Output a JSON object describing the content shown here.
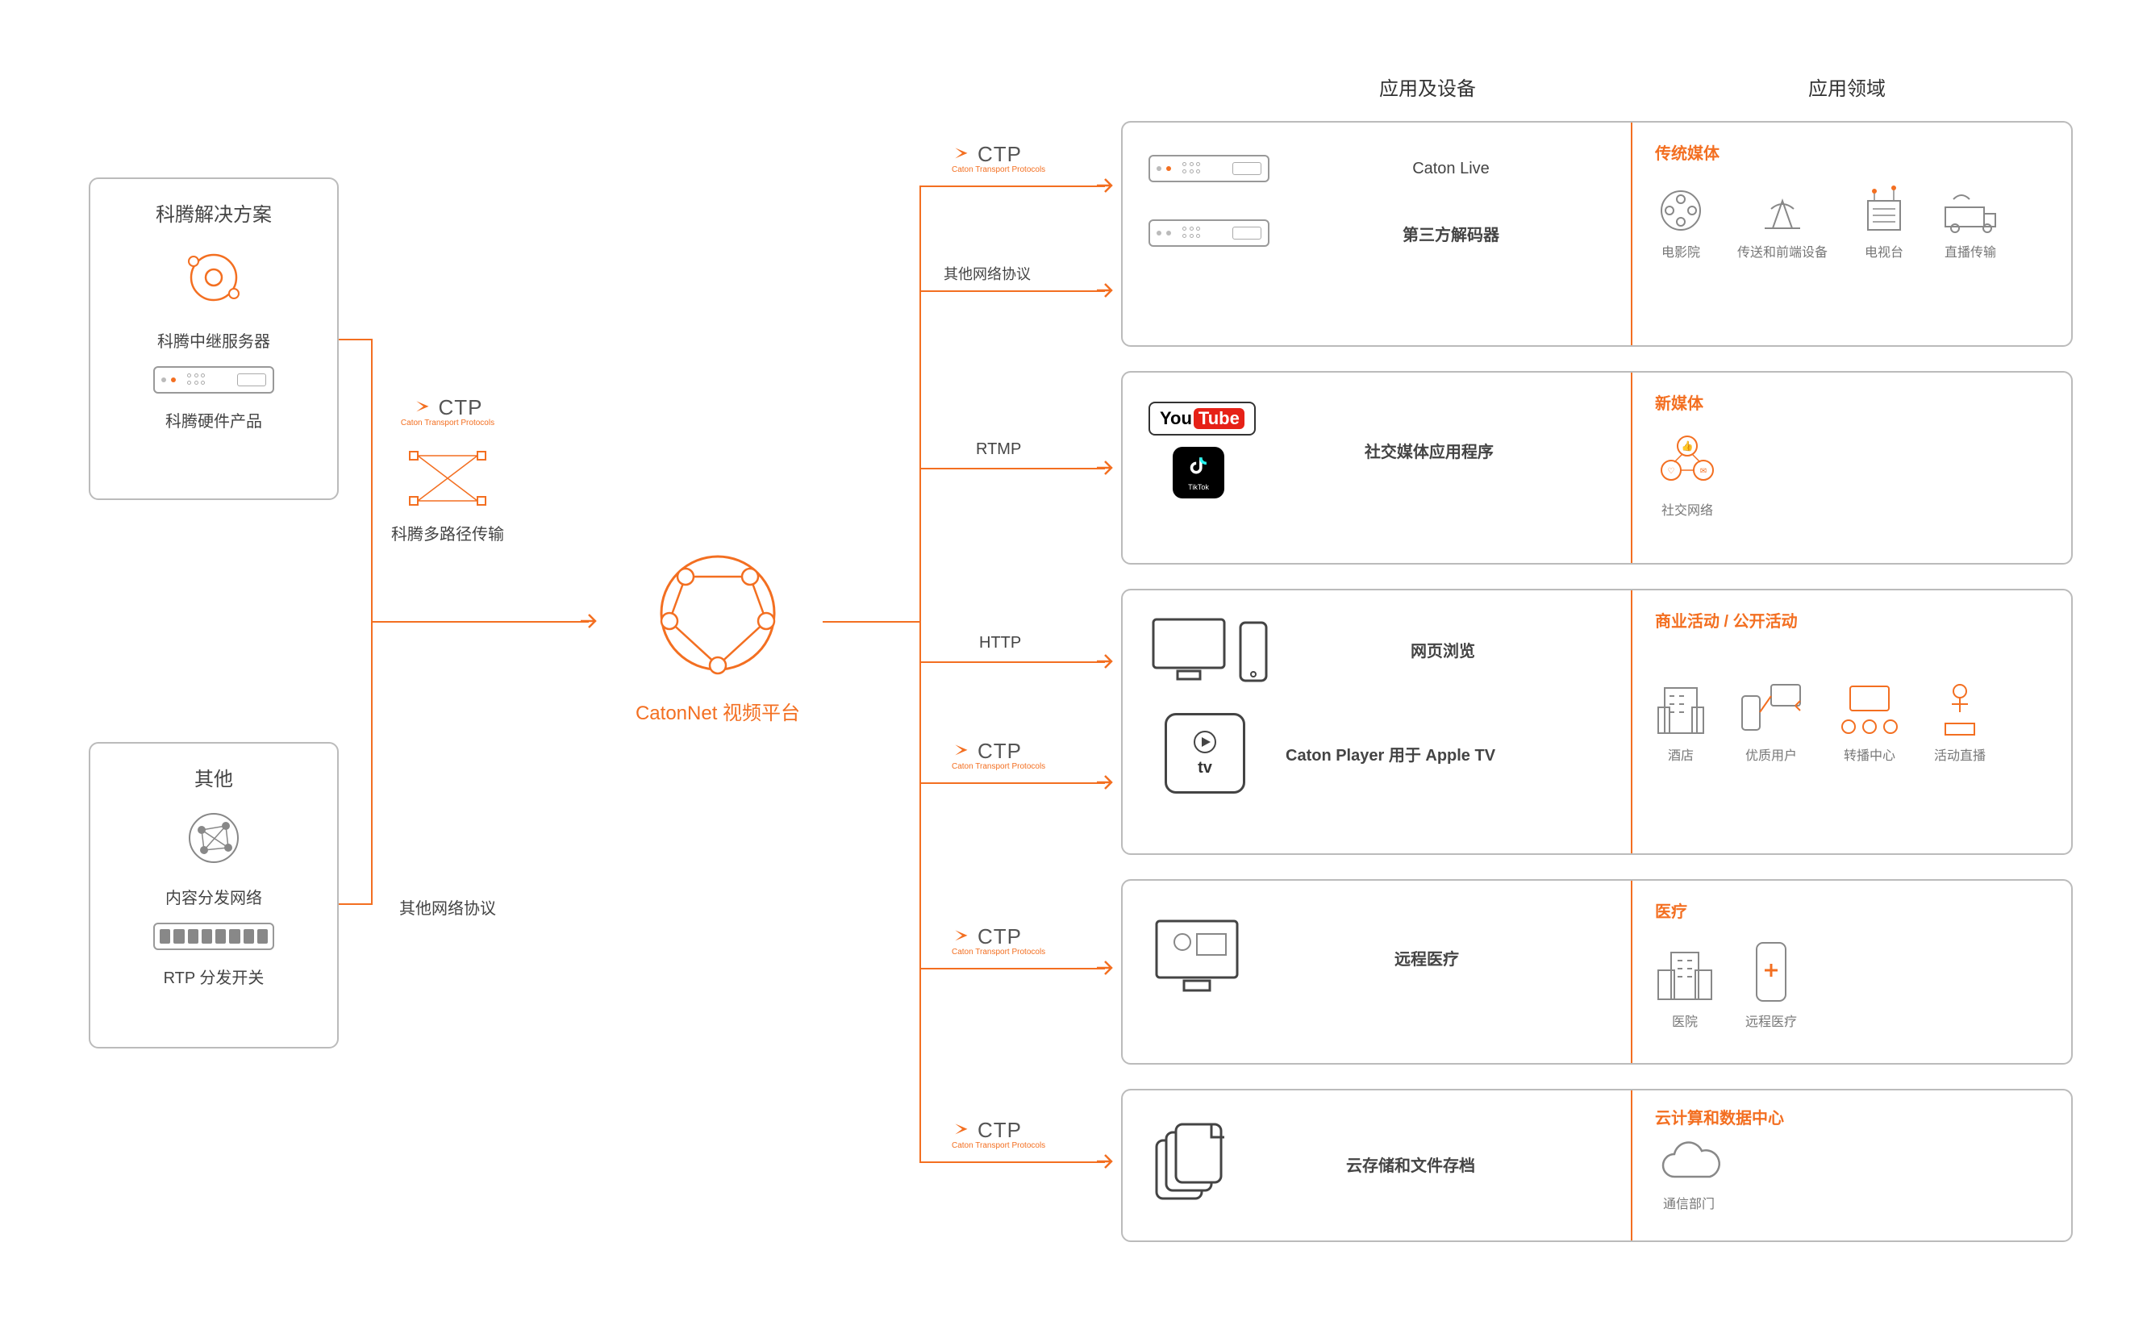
{
  "headers": {
    "apps_devices": "应用及设备",
    "domains": "应用领域"
  },
  "left": {
    "box1_title": "科腾解决方案",
    "box1_item1": "科腾中继服务器",
    "box1_item2": "科腾硬件产品",
    "box2_title": "其他",
    "box2_item1": "内容分发网络",
    "box2_item2": "RTP 分发开关"
  },
  "mid": {
    "ctp": "CTP",
    "ctp_sub": "Caton Transport Protocols",
    "multipath": "科腾多路径传输",
    "other_protocol": "其他网络协议",
    "platform": "CatonNet 视频平台"
  },
  "branches": {
    "b1a": "CTP",
    "b1b": "其他网络协议",
    "b2": "RTMP",
    "b3": "HTTP",
    "b4": "CTP",
    "b5": "CTP",
    "b6": "CTP"
  },
  "panel1": {
    "app1": "Caton Live",
    "app2": "第三方解码器",
    "domain_title": "传统媒体",
    "i1": "电影院",
    "i2": "传送和前端设备",
    "i3": "电视台",
    "i4": "直播传输"
  },
  "panel2": {
    "app": "社交媒体应用程序",
    "yt": "YouTube",
    "domain_title": "新媒体",
    "i1": "社交网络"
  },
  "panel3": {
    "app1": "网页浏览",
    "app2": "Caton Player 用于 Apple TV",
    "domain_title": "商业活动 / 公开活动",
    "i1": "酒店",
    "i2": "优质用户",
    "i3": "转播中心",
    "i4": "活动直播"
  },
  "panel4": {
    "app": "远程医疗",
    "domain_title": "医疗",
    "i1": "医院",
    "i2": "远程医疗"
  },
  "panel5": {
    "app": "云存储和文件存档",
    "domain_title": "云计算和数据中心",
    "i1": "通信部门"
  }
}
